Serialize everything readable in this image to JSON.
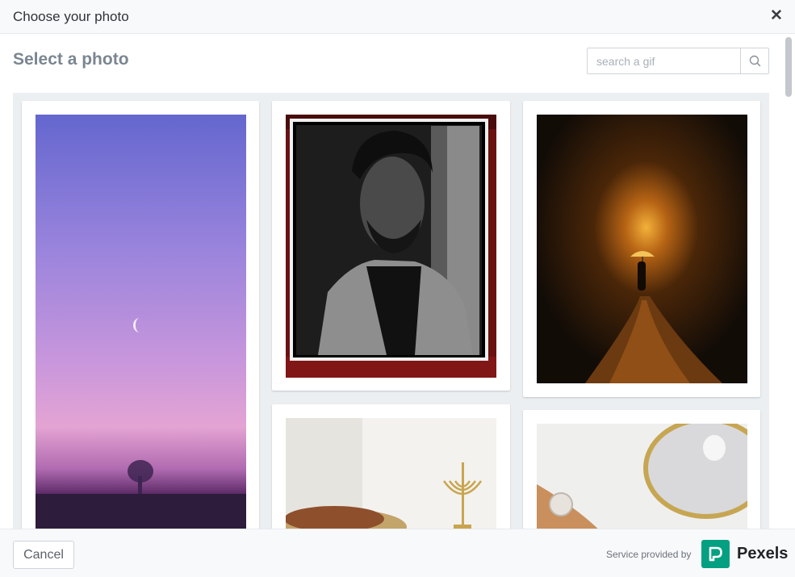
{
  "header": {
    "title": "Choose your photo",
    "close_icon": "close-icon",
    "close_glyph": "✕"
  },
  "main": {
    "section_title": "Select a photo",
    "search": {
      "value": "",
      "placeholder": "search a gif",
      "icon": "search-icon"
    }
  },
  "photos": [
    {
      "subject": "twilight-sky-with-crescent-moon",
      "colors": [
        "#6e6fd0",
        "#a989dd",
        "#dc9fd0",
        "#57205a"
      ]
    },
    {
      "subject": "black-and-white-portrait-of-bearded-man",
      "colors": [
        "#000000",
        "#9d9d9d",
        "#2a2a2a",
        "#8a1b1b"
      ]
    },
    {
      "subject": "person-with-umbrella-on-night-path",
      "colors": [
        "#1b140c",
        "#f0a530",
        "#a35a14",
        "#0d0a07"
      ]
    },
    {
      "subject": "menorah-and-bread-on-table",
      "colors": [
        "#f2f1ee",
        "#cfb36a",
        "#8a4a2a",
        "#c69a5b"
      ]
    },
    {
      "subject": "gold-mirror-tray-and-wooden-board",
      "colors": [
        "#eeeeee",
        "#c9a85a",
        "#b98555",
        "#d8d8dc"
      ]
    }
  ],
  "footer": {
    "cancel_label": "Cancel",
    "provided_label": "Service provided by",
    "provider_name": "Pexels",
    "provider_icon": "pexels-logo-icon",
    "provider_color": "#05a081"
  }
}
